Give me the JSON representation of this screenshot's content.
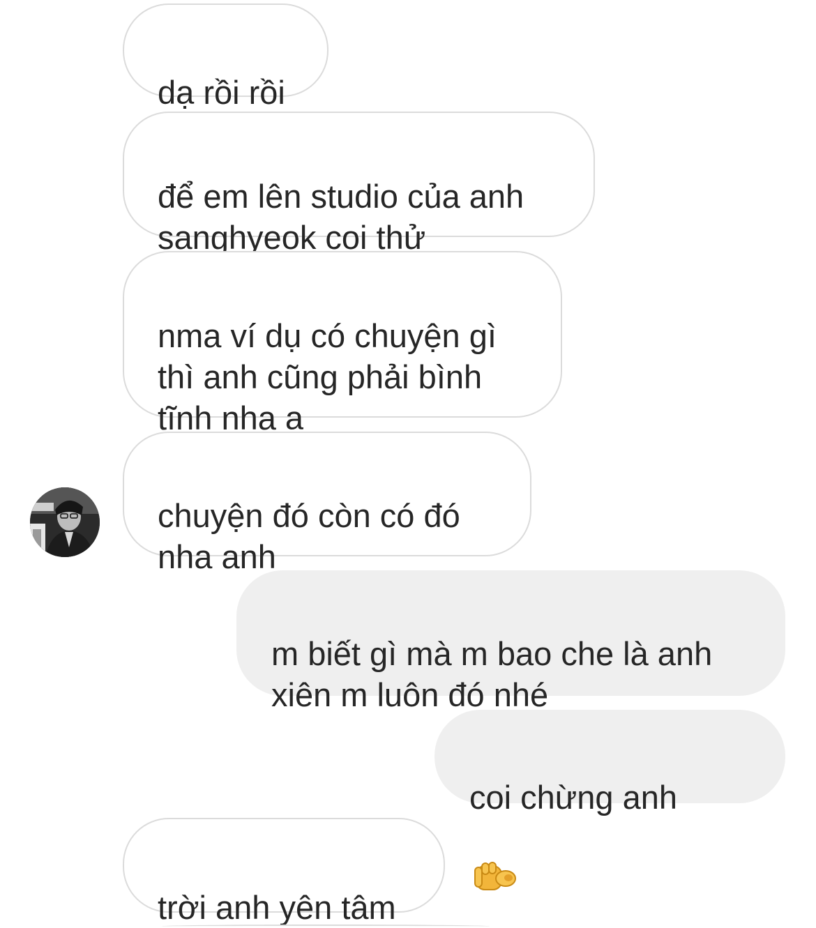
{
  "thread": {
    "messages": [
      {
        "direction": "incoming",
        "text": "dạ rồi rồi"
      },
      {
        "direction": "incoming",
        "text": "để em lên studio của anh\nsanghyeok coi thử"
      },
      {
        "direction": "incoming",
        "text": "nma ví dụ có chuyện gì\nthì anh cũng phải bình\ntĩnh nha ạ"
      },
      {
        "direction": "incoming",
        "text": "chuyện đó còn có đó\nnha anh"
      },
      {
        "direction": "outgoing",
        "text": "m biết gì mà m bao che là anh\nxiên m luôn đó nhé"
      },
      {
        "direction": "outgoing",
        "text": "coi chừng anh",
        "emoji": "backhand-index-pointing-at-viewer"
      },
      {
        "direction": "incoming",
        "text": "trời anh yên tâm"
      }
    ],
    "sender_avatar": "avatar-photo"
  },
  "colors": {
    "incoming_bubble_border": "#dbdbdb",
    "outgoing_bubble_bg": "#efefef",
    "text": "#262626",
    "emoji_skin": "#f2b53a"
  }
}
